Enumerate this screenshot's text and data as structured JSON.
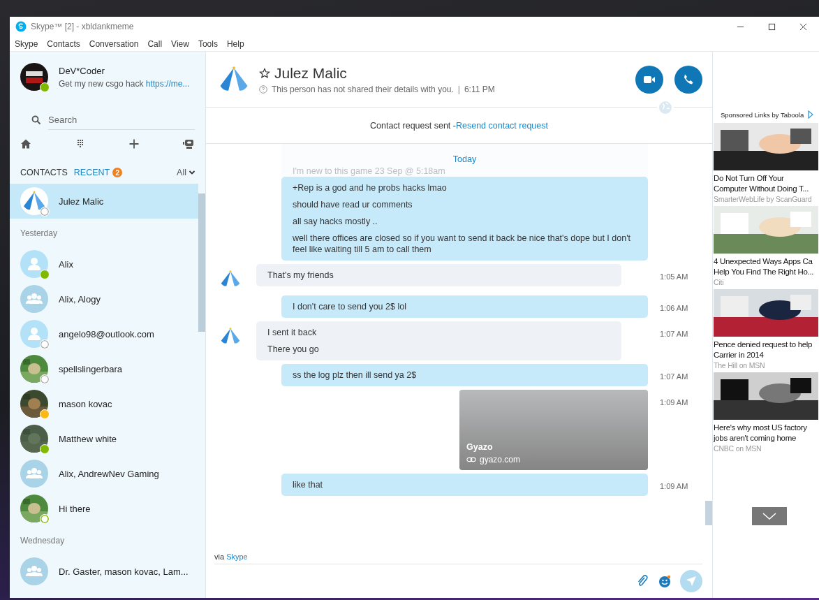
{
  "window": {
    "title": "Skype™ [2] - xbldankmeme"
  },
  "menu": [
    "Skype",
    "Contacts",
    "Conversation",
    "Call",
    "View",
    "Tools",
    "Help"
  ],
  "profile": {
    "name": "DeV*Coder",
    "mood": "Get my new csgo hack ",
    "mood_link": "https://me...",
    "status": {
      "kind": "online"
    }
  },
  "search": {
    "placeholder": "Search"
  },
  "tabs": [
    {
      "label": "CONTACTS",
      "selected": false
    },
    {
      "label": "RECENT",
      "selected": true,
      "badge": "2"
    }
  ],
  "filter": "All",
  "sections": [
    {
      "items": [
        {
          "kind": "logo",
          "name": "Julez Malic",
          "status": {
            "kind": "unknown"
          },
          "selected": true
        }
      ]
    },
    {
      "heading": "Yesterday",
      "items": [
        {
          "kind": "person",
          "name": "Alix",
          "status": {
            "kind": "online"
          },
          "selected": false
        },
        {
          "kind": "group",
          "name": "Alix, Alogy",
          "selected": false
        },
        {
          "kind": "person",
          "name": "angelo98@outlook.com",
          "status": {
            "kind": "unknown"
          },
          "selected": false
        },
        {
          "kind": "picture",
          "name": "spellslingerbara",
          "status": {
            "kind": "unknown"
          },
          "selected": false
        },
        {
          "kind": "picture",
          "name": "mason kovac",
          "status": {
            "kind": "away"
          },
          "selected": false
        },
        {
          "kind": "picture",
          "name": "Matthew white",
          "status": {
            "kind": "online"
          },
          "selected": false
        },
        {
          "kind": "group",
          "name": "Alix, AndrewNev Gaming",
          "selected": false
        },
        {
          "kind": "picture",
          "name": "Hi there",
          "status": {
            "kind": "ring"
          },
          "selected": false
        }
      ]
    },
    {
      "heading": "Wednesday",
      "items": [
        {
          "kind": "group",
          "name": "Dr. Gaster, mason kovac, Lam...",
          "selected": false
        }
      ]
    }
  ],
  "chat": {
    "name": "Julez Malic",
    "favorite": false,
    "info": "This person has not shared their details with you.",
    "separator": "|",
    "time": "6:11 PM"
  },
  "request": {
    "text": "Contact request sent - ",
    "link": "Resend contact request"
  },
  "day": "Today",
  "faded": "I'm new to this game 23 Sep @ 5:18am",
  "messages": [
    {
      "kind": "outgoing_text",
      "lines": [
        "+Rep is a god and he probs hacks lmao",
        "should have read ur comments",
        "all say hacks mostly ..",
        "well there offices are closed so if you want to send it back be nice that's dope but I don't feel like waiting till 5 am to call them"
      ]
    },
    {
      "kind": "incoming_text",
      "lines": [
        "That's my friends"
      ],
      "time": "1:05 AM"
    },
    {
      "kind": "outgoing_text",
      "lines": [
        "I don't care to send you 2$ lol"
      ],
      "time": "1:06 AM"
    },
    {
      "kind": "incoming_text",
      "lines": [
        "I sent it back",
        "There you go"
      ],
      "time": "1:07 AM"
    },
    {
      "kind": "outgoing_text",
      "lines": [
        "ss the log plz then ill send ya 2$"
      ],
      "time": "1:07 AM"
    },
    {
      "kind": "outgoing_link_preview",
      "title": "Gyazo",
      "site": "gyazo.com",
      "time": "1:09 AM"
    },
    {
      "kind": "outgoing_text",
      "lines": [
        "like that"
      ],
      "time": "1:09 AM"
    }
  ],
  "via": {
    "text": "via ",
    "link": "Skype"
  },
  "ads": {
    "header": "Sponsored Links by Taboola",
    "items": [
      {
        "kind": "picture",
        "title": [
          "Do Not Turn Off Your",
          "Computer Without Doing T..."
        ],
        "source": "SmarterWebLife by ScanGuard"
      },
      {
        "kind": "picture",
        "title": [
          "4 Unexpected Ways Apps Ca",
          "Help You Find The Right Ho..."
        ],
        "source": "Citi"
      },
      {
        "kind": "picture",
        "title": [
          "Pence denied request to help",
          "Carrier in 2014"
        ],
        "source": "The Hill on MSN"
      },
      {
        "kind": "picture",
        "title": [
          "Here's why most US factory",
          "jobs aren't coming home"
        ],
        "source": "CNBC on MSN"
      }
    ]
  }
}
